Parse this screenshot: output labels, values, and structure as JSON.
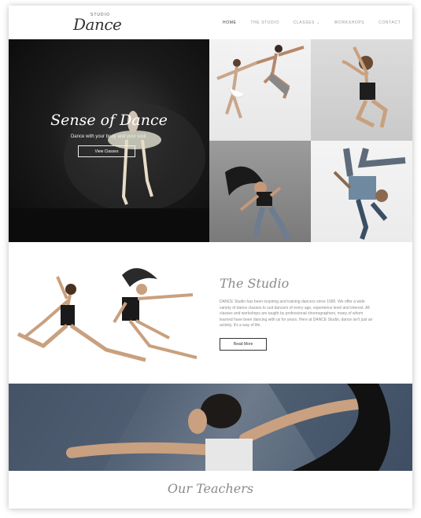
{
  "header": {
    "logo": {
      "small": "STUDIO",
      "main": "Dance"
    },
    "nav": [
      {
        "label": "HOME"
      },
      {
        "label": "THE STUDIO"
      },
      {
        "label": "CLASSES"
      },
      {
        "label": "WORKSHOPS"
      },
      {
        "label": "CONTACT"
      }
    ]
  },
  "hero": {
    "title": "Sense of Dance",
    "subtitle": "Dance with your body and your soul.",
    "button": "View Classes"
  },
  "studio": {
    "title": "The Studio",
    "text": "DANCE Studio has been inspiring and training dancers since 1995. We offer a wide variety of dance classes to suit dancers of every age, experience level and interest. All classes and workshops are taught by professional choreographers, many of whom learned have been dancing with us for years. Here at DANCE Studio, dance isn't just an activity, it's a way of life.",
    "button": "Read More"
  },
  "teachers": {
    "title": "Our Teachers"
  },
  "colors": {
    "accent_dark": "#333333",
    "muted_text": "#8c8c8c",
    "banner": "#566478"
  }
}
